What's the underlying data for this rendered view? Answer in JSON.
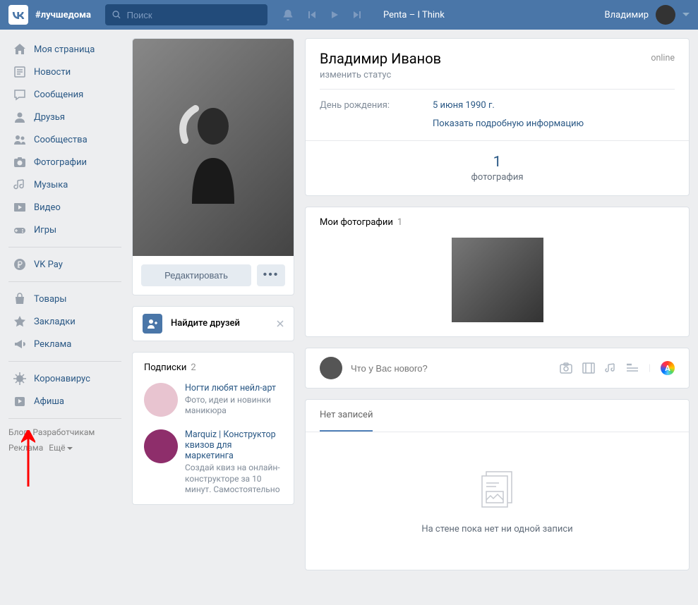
{
  "header": {
    "hashtag": "#лучшедома",
    "search_placeholder": "Поиск",
    "player_track": "Penta – I Think",
    "username": "Владимир"
  },
  "sidebar": {
    "items": [
      {
        "label": "Моя страница",
        "icon": "home"
      },
      {
        "label": "Новости",
        "icon": "news"
      },
      {
        "label": "Сообщения",
        "icon": "messages"
      },
      {
        "label": "Друзья",
        "icon": "friends"
      },
      {
        "label": "Сообщества",
        "icon": "groups"
      },
      {
        "label": "Фотографии",
        "icon": "photos"
      },
      {
        "label": "Музыка",
        "icon": "music"
      },
      {
        "label": "Видео",
        "icon": "video"
      },
      {
        "label": "Игры",
        "icon": "games"
      }
    ],
    "items2": [
      {
        "label": "VK Pay",
        "icon": "pay"
      }
    ],
    "items3": [
      {
        "label": "Товары",
        "icon": "market"
      },
      {
        "label": "Закладки",
        "icon": "bookmarks"
      },
      {
        "label": "Реклама",
        "icon": "ads"
      }
    ],
    "items4": [
      {
        "label": "Коронавирус",
        "icon": "virus"
      },
      {
        "label": "Афиша",
        "icon": "events"
      }
    ]
  },
  "footer": {
    "blog": "Блог",
    "developers": "Разработчикам",
    "ads": "Реклама",
    "more": "Ещё"
  },
  "profile_card": {
    "edit_label": "Редактировать"
  },
  "find_friends": {
    "label": "Найдите друзей"
  },
  "subscriptions": {
    "title": "Подписки",
    "count": "2",
    "items": [
      {
        "title": "Ногти любят нейл-арт",
        "desc": "Фото, идеи и новинки маникюра"
      },
      {
        "title": "Marquiz | Конструктор квизов для маркетинга",
        "desc": "Создай квиз на онлайн-конструкторе за 10 минут. Самостоятельно"
      }
    ]
  },
  "profile": {
    "name": "Владимир Иванов",
    "status_placeholder": "изменить статус",
    "online": "online",
    "birthday_label": "День рождения:",
    "birthday_value": "5 июня 1990 г.",
    "more_info": "Показать подробную информацию",
    "counter_num": "1",
    "counter_label": "фотография"
  },
  "photos": {
    "title": "Мои фотографии",
    "count": "1"
  },
  "post": {
    "placeholder": "Что у Вас нового?"
  },
  "wall": {
    "tab_label": "Нет записей",
    "empty_text": "На стене пока нет ни одной записи"
  }
}
